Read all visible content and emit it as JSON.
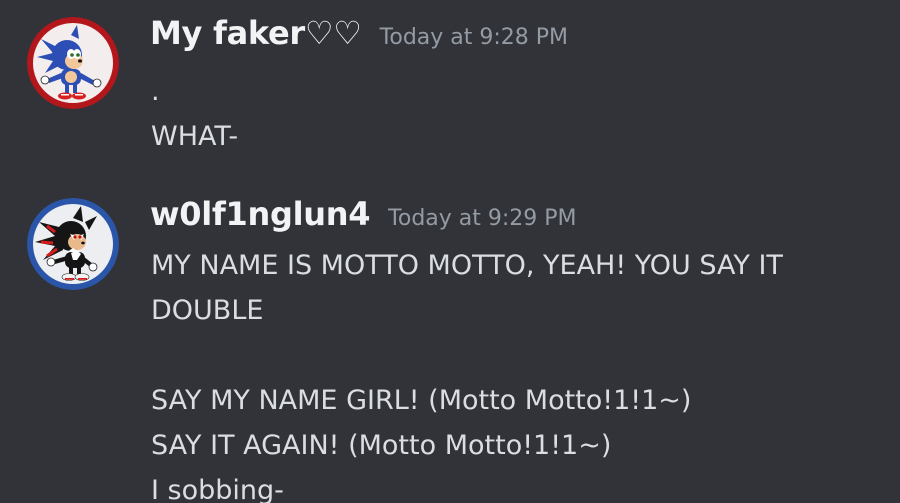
{
  "messages": [
    {
      "username": "My faker♡♡",
      "timestamp": "Today at 9:28 PM",
      "avatar_icon": "sonic-avatar-icon",
      "lines": [
        ".",
        "WHAT-"
      ]
    },
    {
      "username": "w0lf1nglun4",
      "timestamp": "Today at 9:29 PM",
      "avatar_icon": "shadow-avatar-icon",
      "lines": [
        "MY NAME IS MOTTO MOTTO, YEAH! YOU SAY IT",
        "DOUBLE",
        "",
        "SAY MY NAME GIRL! (Motto Motto!1!1~)",
        "SAY IT AGAIN! (Motto Motto!1!1~)",
        "I sobbing-"
      ]
    }
  ],
  "colors": {
    "background": "#313338",
    "username": "#f2f3f5",
    "timestamp": "#949ba4",
    "text": "#dbdee1"
  }
}
